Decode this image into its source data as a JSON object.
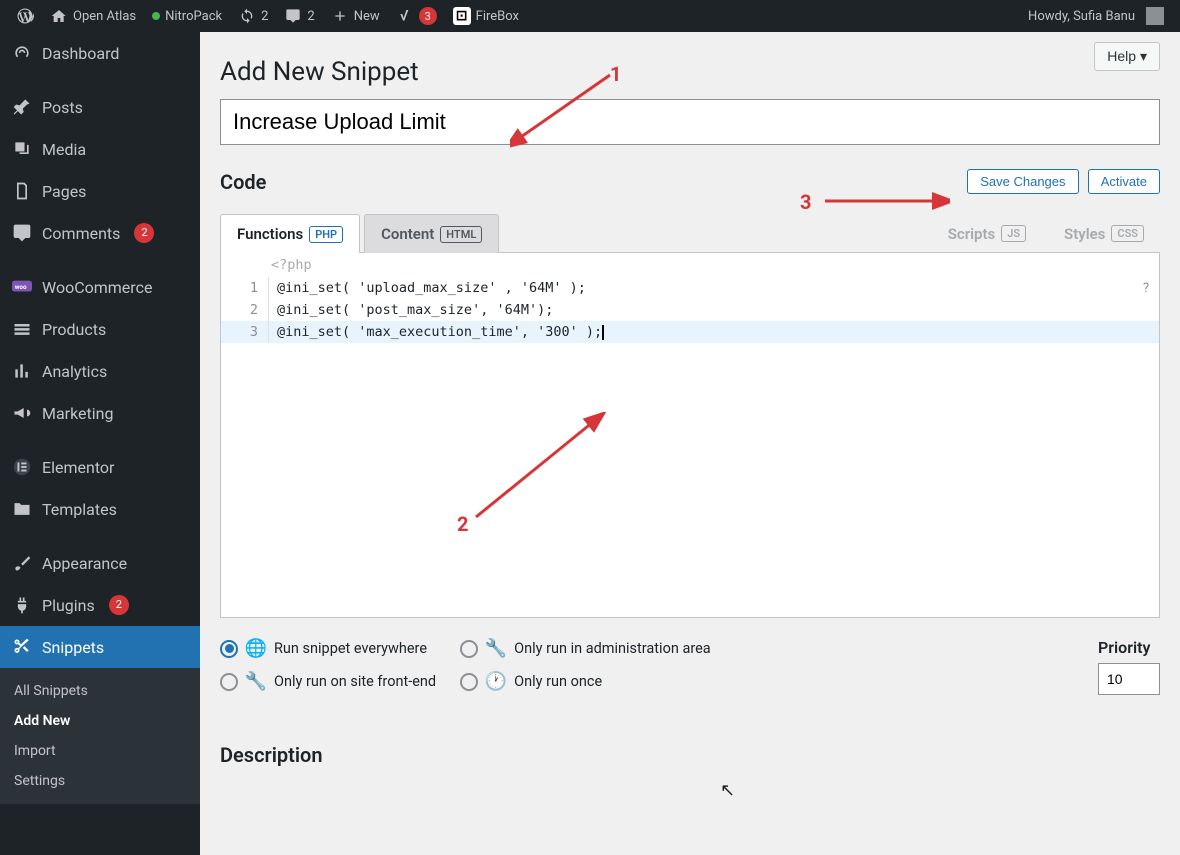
{
  "adminbar": {
    "site_name": "Open Atlas",
    "nitropack": "NitroPack",
    "update_count": "2",
    "comments_count": "2",
    "new_label": "New",
    "yoast_badge": "3",
    "firebox": "FireBox",
    "greeting": "Howdy, Sufia Banu"
  },
  "sidebar": {
    "dashboard": "Dashboard",
    "posts": "Posts",
    "media": "Media",
    "pages": "Pages",
    "comments": "Comments",
    "comments_badge": "2",
    "woocommerce": "WooCommerce",
    "products": "Products",
    "analytics": "Analytics",
    "marketing": "Marketing",
    "elementor": "Elementor",
    "templates": "Templates",
    "appearance": "Appearance",
    "plugins": "Plugins",
    "plugins_badge": "2",
    "snippets": "Snippets",
    "submenu": {
      "all": "All Snippets",
      "add": "Add New",
      "import": "Import",
      "settings": "Settings"
    }
  },
  "main": {
    "help": "Help",
    "page_title": "Add New Snippet",
    "title_value": "Increase Upload Limit",
    "code_heading": "Code",
    "save_btn": "Save Changes",
    "activate_btn": "Activate",
    "tabs": {
      "functions": "Functions",
      "functions_lang": "PHP",
      "content": "Content",
      "content_lang": "HTML",
      "scripts": "Scripts",
      "scripts_lang": "JS",
      "styles": "Styles",
      "styles_lang": "CSS"
    },
    "editor": {
      "php_open": "<?php",
      "lines": [
        "@ini_set( 'upload_max_size' , '64M' );",
        "@ini_set( 'post_max_size', '64M');",
        "@ini_set( 'max_execution_time', '300' );"
      ],
      "help_mark": "?"
    },
    "run_options": {
      "everywhere": "Run snippet everywhere",
      "admin": "Only run in administration area",
      "frontend": "Only run on site front-end",
      "once": "Only run once"
    },
    "priority_label": "Priority",
    "priority_value": "10",
    "description_heading": "Description"
  },
  "annotations": {
    "n1": "1",
    "n2": "2",
    "n3": "3"
  }
}
